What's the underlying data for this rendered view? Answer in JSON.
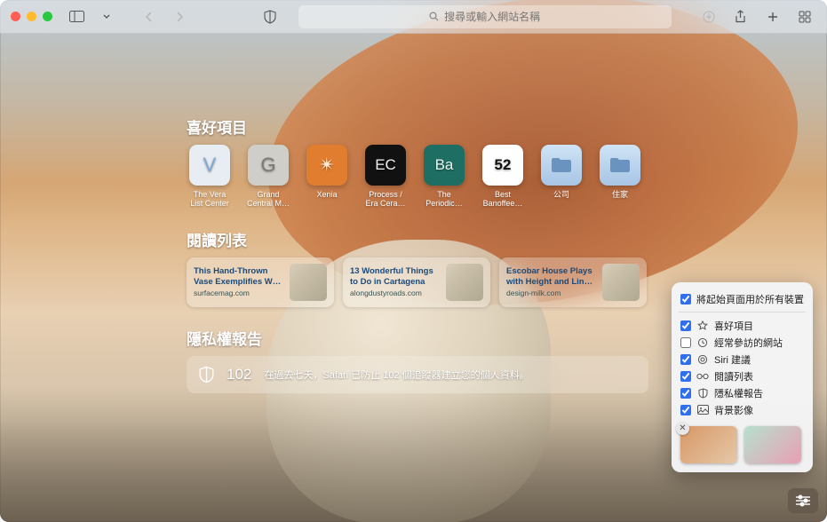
{
  "toolbar": {
    "search_placeholder": "搜尋或輸入網站名稱"
  },
  "sections": {
    "favorites_title": "喜好項目",
    "reading_title": "閱讀列表",
    "privacy_title": "隱私權報告"
  },
  "favorites": [
    {
      "label": "The Vera List Center",
      "glyph": "V",
      "bg": "#e8edf3",
      "fg": "#7fa9d4"
    },
    {
      "label": "Grand Central M…",
      "glyph": "G",
      "bg": "#d0cec9",
      "fg": "#7d7b77"
    },
    {
      "label": "Xenia",
      "glyph": "✴",
      "bg": "#e07d2f",
      "fg": "#ffe9d2"
    },
    {
      "label": "Process / Era Cera…",
      "glyph": "EC",
      "bg": "#111111",
      "fg": "#f2f2f2"
    },
    {
      "label": "The Periodic…",
      "glyph": "Ba",
      "bg": "#1f6e63",
      "fg": "#eaf5f2"
    },
    {
      "label": "Best Banoffee…",
      "glyph": "52",
      "bg": "#ffffff",
      "fg": "#111111"
    },
    {
      "label": "公司",
      "glyph": "folder",
      "bg": "folder",
      "fg": ""
    },
    {
      "label": "住家",
      "glyph": "folder",
      "bg": "folder",
      "fg": ""
    }
  ],
  "reading": [
    {
      "title": "This Hand-Thrown Vase Exemplifies Why Cera…",
      "source": "surfacemag.com"
    },
    {
      "title": "13 Wonderful Things to Do in Cartagena",
      "source": "alongdustyroads.com"
    },
    {
      "title": "Escobar House Plays with Height and Lines t…",
      "source": "design-milk.com"
    }
  ],
  "privacy": {
    "count": "102",
    "text": "在過去七天，Safari 已防止 102 個追蹤器建立您的個人資料。"
  },
  "popover": {
    "sync_label": "將起始頁面用於所有裝置",
    "opts": [
      {
        "label": "喜好項目",
        "icon": "star",
        "checked": true
      },
      {
        "label": "經常參訪的網站",
        "icon": "clock",
        "checked": false
      },
      {
        "label": "Siri 建議",
        "icon": "siri",
        "checked": true
      },
      {
        "label": "閱讀列表",
        "icon": "glasses",
        "checked": true
      },
      {
        "label": "隱私權報告",
        "icon": "shield",
        "checked": true
      },
      {
        "label": "背景影像",
        "icon": "image",
        "checked": true
      }
    ]
  }
}
